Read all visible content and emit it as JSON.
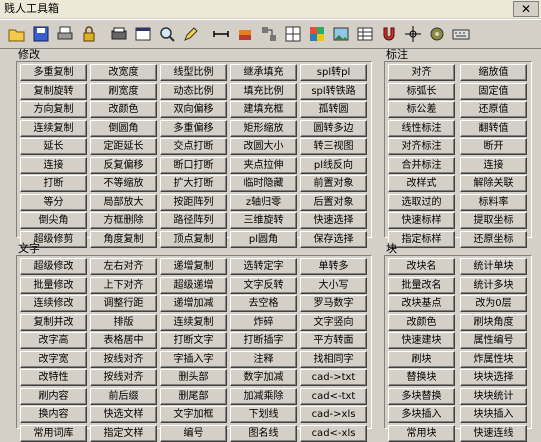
{
  "window": {
    "title": "贱人工具箱",
    "close_glyph": "✕"
  },
  "toolbar": {
    "icons": [
      "folder-open-icon",
      "save-icon",
      "print-icon",
      "lock-icon",
      "printer-icon",
      "window-icon",
      "search-icon",
      "pencil-icon",
      "dimension-icon",
      "layer-icon",
      "block-icon",
      "grid-icon",
      "color-icon",
      "image-icon",
      "table-icon",
      "magnet-icon",
      "crosshair-icon",
      "gear-icon",
      "keyboard-icon"
    ]
  },
  "sections": {
    "modify": {
      "label": "修改",
      "buttons": [
        "多重复制",
        "改宽度",
        "线型比例",
        "继承填充",
        "spl转pl",
        "复制旋转",
        "刷宽度",
        "动态比例",
        "填充比例",
        "spl转铁路",
        "方向复制",
        "改颜色",
        "双向偏移",
        "建填充框",
        "孤转圆",
        "连续复制",
        "倒圆角",
        "多重偏移",
        "矩形缩放",
        "圆转多边",
        "延长",
        "定距延长",
        "交点打断",
        "改圆大小",
        "转三视图",
        "连接",
        "反复偏移",
        "断口打断",
        "夹点拉伸",
        "pl线反向",
        "打断",
        "不等缩放",
        "扩大打断",
        "临时隐藏",
        "前置对象",
        "等分",
        "局部放大",
        "按距阵列",
        "z轴归零",
        "后置对象",
        "倒尖角",
        "方框删除",
        "路径阵列",
        "三维旋转",
        "快速选择",
        "超级修剪",
        "角度复制",
        "顶点复制",
        "pl圆角",
        "保存选择"
      ]
    },
    "dimension": {
      "label": "标注",
      "buttons": [
        "对齐",
        "缩放值",
        "标弧长",
        "固定值",
        "标公差",
        "还原值",
        "线性标注",
        "翻转值",
        "对齐标注",
        "断开",
        "合并标注",
        "连接",
        "改样式",
        "解除关联",
        "选取过的",
        "标料率",
        "快速标样",
        "提取坐标",
        "指定标样",
        "还原坐标"
      ]
    },
    "text": {
      "label": "文字",
      "buttons": [
        "超级修改",
        "左右对齐",
        "递增复制",
        "选转定字",
        "单转多",
        "批量修改",
        "上下对齐",
        "超级递增",
        "文字反转",
        "大小写",
        "连续修改",
        "调整行距",
        "递增加减",
        "去空格",
        "罗马数字",
        "复制并改",
        "排版",
        "连续复制",
        "炸碎",
        "文字竖向",
        "改字高",
        "表格居中",
        "打断文字",
        "打断插字",
        "平方转面",
        "改字宽",
        "按线对齐",
        "字插入字",
        "注释",
        "找相同字",
        "改特性",
        "按线对齐",
        "删头部",
        "数字加减",
        "cad->txt",
        "刷内容",
        "前后缀",
        "删尾部",
        "加减乘除",
        "cad<-txt",
        "换内容",
        "快选文样",
        "文字加框",
        "下划线",
        "cad->xls",
        "常用词库",
        "指定文样",
        "编号",
        "图名线",
        "cad<-xls"
      ]
    },
    "block": {
      "label": "块",
      "buttons": [
        "改块名",
        "统计单块",
        "批量改名",
        "统计多块",
        "改块基点",
        "改为0层",
        "改颜色",
        "刷块角度",
        "快速建块",
        "属性编号",
        "刷块",
        "炸属性块",
        "替换块",
        "块块选择",
        "多块替换",
        "块块统计",
        "多块插入",
        "块块插入",
        "常用块",
        "快速连线"
      ]
    }
  }
}
